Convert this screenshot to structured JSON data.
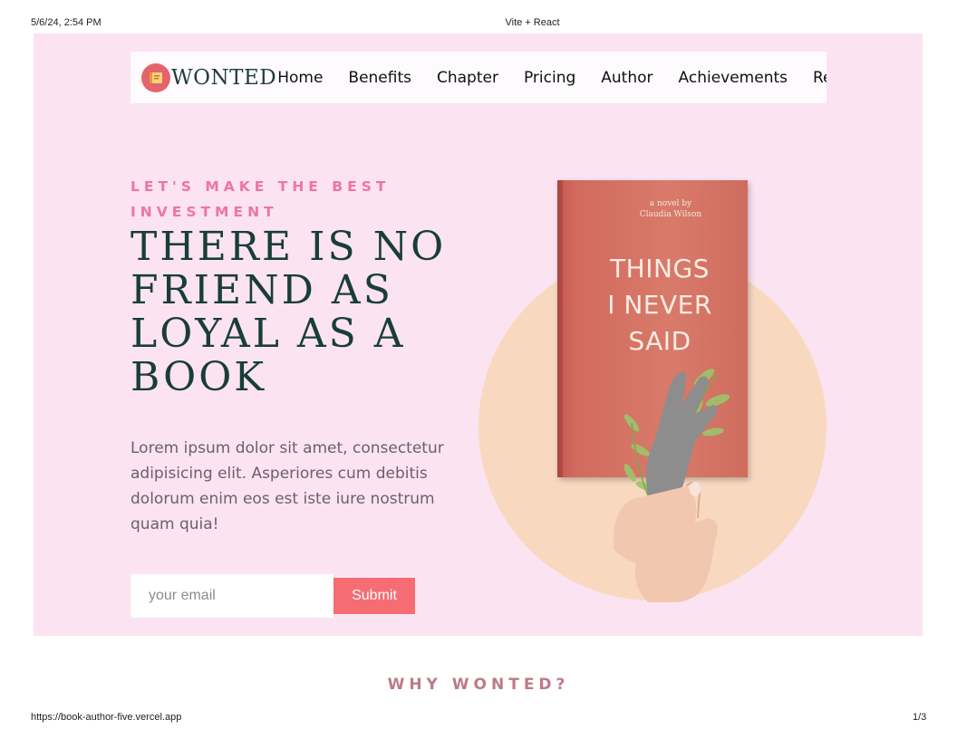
{
  "print": {
    "date": "5/6/24, 2:54 PM",
    "title": "Vite + React",
    "url": "https://book-author-five.vercel.app",
    "page": "1/3"
  },
  "brand": {
    "name": "WONTED",
    "logo_icon": "book-logo-icon",
    "logo_color": "#e5636b"
  },
  "nav": {
    "items": [
      {
        "label": "Home"
      },
      {
        "label": "Benefits"
      },
      {
        "label": "Chapter"
      },
      {
        "label": "Pricing"
      },
      {
        "label": "Author"
      },
      {
        "label": "Achievements"
      },
      {
        "label": "Reviews"
      }
    ]
  },
  "hero": {
    "eyebrow_line1": "LET'S MAKE THE BEST",
    "eyebrow_line2": "INVESTMENT",
    "headline_line1": "THERE IS NO",
    "headline_line2": "FRIEND AS",
    "headline_line3": "LOYAL AS A",
    "headline_line4": "BOOK",
    "description": "Lorem ipsum dolor sit amet, consectetur adipisicing elit. Asperiores cum debitis dolorum enim eos est iste iure nostrum quam quia!",
    "email_placeholder": "your email",
    "submit_label": "Submit"
  },
  "book": {
    "byline_line1": "a novel by",
    "byline_line2": "Claudia Wilson",
    "title_line1": "THINGS",
    "title_line2": "I NEVER",
    "title_line3": "SAID"
  },
  "section": {
    "why_title": "WHY WONTED?"
  },
  "colors": {
    "hero_bg": "#fbe3f1",
    "accent_pink": "#ee74a8",
    "headline_green": "#183d3a",
    "submit_bg": "#f56d73",
    "circle": "#f8d9c0",
    "book_cover": "#d87a6a",
    "why_title": "#bd7a88"
  }
}
